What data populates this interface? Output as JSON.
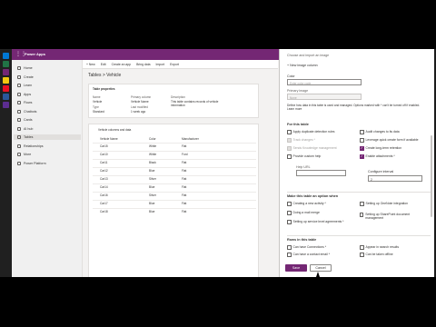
{
  "app": {
    "brand": "Power Apps"
  },
  "taskbar": {
    "icons": [
      "#0078d4",
      "#217346",
      "#742774",
      "#f2c811",
      "#e81123",
      "#2b579a",
      "#5c2d91"
    ]
  },
  "nav": {
    "items": [
      "Home",
      "Create",
      "Learn",
      "Apps",
      "Flows",
      "Chatbots",
      "Cards",
      "AI hub",
      "Tables",
      "Relationships",
      "More",
      "Power Platform"
    ],
    "active_index": 8
  },
  "commands": [
    "+ New",
    "Edit",
    "Create an app",
    "Bring data",
    "Import",
    "Export"
  ],
  "main": {
    "breadcrumb": "Tables > Vehicle",
    "props": {
      "title": "Table properties",
      "headers": [
        "Name",
        "Primary column",
        "Description"
      ],
      "rows": [
        [
          "Vehicle",
          "Vehicle Name",
          "This table contains records of vehicle information"
        ],
        [
          "Type",
          "Last modified",
          ""
        ],
        [
          "Standard",
          "1 week ago",
          ""
        ]
      ]
    },
    "table": {
      "title": "Vehicle columns and data",
      "columns": [
        "Vehicle Name",
        "Color",
        "Manufacturer",
        ""
      ],
      "rows": [
        [
          "Car15",
          "White",
          "Fiat"
        ],
        [
          "Car10",
          "White",
          "Ford"
        ],
        [
          "Car11",
          "Black",
          "Fiat"
        ],
        [
          "Car12",
          "Blue",
          "Fiat"
        ],
        [
          "Car13",
          "Silver",
          "Fiat"
        ],
        [
          "Car14",
          "Blue",
          "Fiat"
        ],
        [
          "Car16",
          "Silver",
          "Fiat"
        ],
        [
          "Car17",
          "Blue",
          "Fiat"
        ],
        [
          "Car18",
          "Blue",
          "Fiat"
        ]
      ]
    }
  },
  "panel": {
    "top_link": "Choose and import an image",
    "new_image_col": "+ New image column",
    "color_label": "Color",
    "color_placeholder": "Enter color code",
    "primary_image_label": "Primary image",
    "primary_image_value": "None",
    "apply_note": "Define how data in this table is used and managed. Options marked with * can't be turned off if enabled. Learn more",
    "for_this_table": "For this table",
    "left_checks": [
      {
        "label": "Apply duplicate detection rules",
        "state": "off"
      },
      {
        "label": "Track changes *",
        "state": "disabled"
      },
      {
        "label": "Sends Knowledge management",
        "state": "disabled"
      },
      {
        "label": "Provide custom help",
        "state": "off"
      }
    ],
    "right_checks": [
      {
        "label": "Audit changes to its data",
        "state": "off"
      },
      {
        "label": "Leverage quick create form if available",
        "state": "off"
      },
      {
        "label": "Create long-term retention",
        "state": "on"
      },
      {
        "label": "Enable attachments *",
        "state": "on"
      }
    ],
    "help_url_label": "Help URL",
    "config_interval_label": "Configure interval",
    "config_interval_value": "2",
    "make_available": "Make this table an option when",
    "mk_left": [
      {
        "label": "Creating a new activity *",
        "state": "off"
      },
      {
        "label": "Doing a mail merge",
        "state": "off"
      },
      {
        "label": "Setting up service level agreements *",
        "state": "off"
      }
    ],
    "mk_right": [
      {
        "label": "Setting up OneNote integration",
        "state": "off"
      },
      {
        "label": "Setting up SharePoint document management",
        "state": "off"
      }
    ],
    "rows_in_table": "Rows in this table",
    "rows_left": [
      {
        "label": "Can have Connections *",
        "state": "off"
      },
      {
        "label": "Can have a contact email *",
        "state": "off"
      }
    ],
    "rows_right": [
      {
        "label": "Appear in search results",
        "state": "off"
      },
      {
        "label": "Can be taken offline",
        "state": "off"
      }
    ],
    "save_label": "Save",
    "cancel_label": "Cancel"
  }
}
